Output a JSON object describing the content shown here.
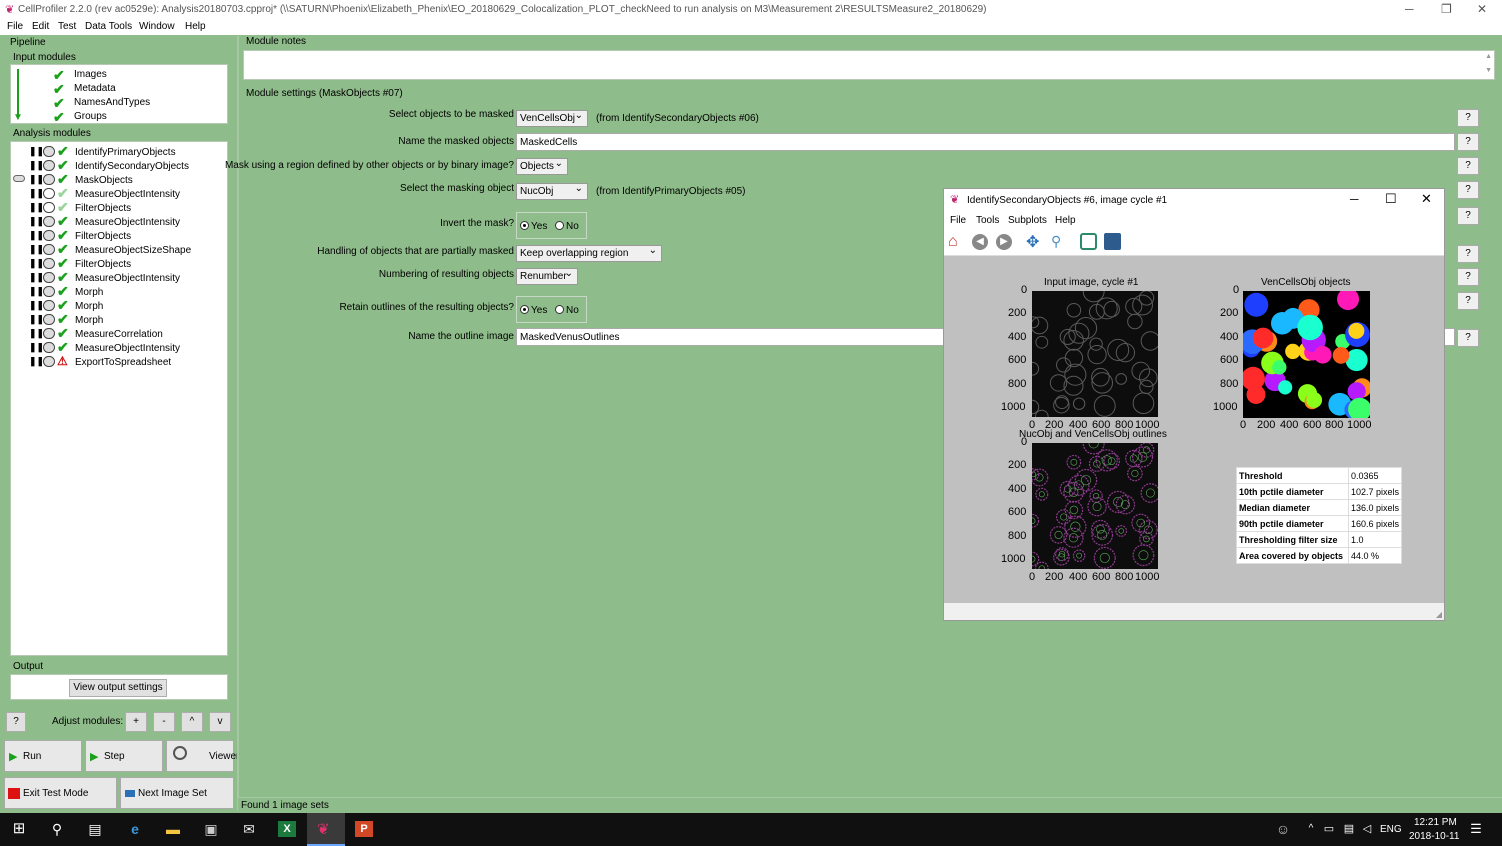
{
  "window": {
    "title": "CellProfiler 2.2.0 (rev ac0529e): Analysis20180703.cpproj* (\\\\SATURN\\Phoenix\\Elizabeth_Phenix\\EO_20180629_Colocalization_PLOT_checkNeed to run analysis on M3\\Measurement 2\\RESULTSMeasure2_20180629)",
    "minimize": "─",
    "restore": "❐",
    "close": "✕"
  },
  "menu": [
    "File",
    "Edit",
    "Test",
    "Data Tools",
    "Window",
    "Help"
  ],
  "pipeline": {
    "title": "Pipeline",
    "input_title": "Input modules",
    "input_modules": [
      "Images",
      "Metadata",
      "NamesAndTypes",
      "Groups"
    ],
    "analysis_title": "Analysis modules",
    "analysis_modules": [
      {
        "name": "IdentifyPrimaryObjects",
        "status": "ok"
      },
      {
        "name": "IdentifySecondaryObjects",
        "status": "ok"
      },
      {
        "name": "MaskObjects",
        "status": "ok"
      },
      {
        "name": "MeasureObjectIntensity",
        "status": "pending"
      },
      {
        "name": "FilterObjects",
        "status": "pending"
      },
      {
        "name": "MeasureObjectIntensity",
        "status": "ok"
      },
      {
        "name": "FilterObjects",
        "status": "ok"
      },
      {
        "name": "MeasureObjectSizeShape",
        "status": "ok"
      },
      {
        "name": "FilterObjects",
        "status": "ok"
      },
      {
        "name": "MeasureObjectIntensity",
        "status": "ok"
      },
      {
        "name": "Morph",
        "status": "ok"
      },
      {
        "name": "Morph",
        "status": "ok"
      },
      {
        "name": "Morph",
        "status": "ok"
      },
      {
        "name": "MeasureCorrelation",
        "status": "ok"
      },
      {
        "name": "MeasureObjectIntensity",
        "status": "ok"
      },
      {
        "name": "ExportToSpreadsheet",
        "status": "error"
      }
    ]
  },
  "output": {
    "title": "Output",
    "view_button": "View output settings"
  },
  "adjust": {
    "help": "?",
    "label": "Adjust modules:",
    "add": "+",
    "remove": "-",
    "up": "^",
    "down": "v"
  },
  "actions": {
    "run": "Run",
    "step": "Step",
    "viewer": "Viewer",
    "exit_test": "Exit Test Mode",
    "next_set": "Next Image Set"
  },
  "module_notes_title": "Module notes",
  "settings": {
    "title": "Module settings (MaskObjects #07)",
    "help": "?",
    "objects_label": "Select objects to be masked",
    "objects_value": "VenCellsObj",
    "objects_note": "(from IdentifySecondaryObjects #06)",
    "masked_name_label": "Name the masked objects",
    "masked_name_value": "MaskedCells",
    "mask_using_label": "Mask using a region defined by other objects or by binary image?",
    "mask_using_value": "Objects",
    "masking_object_label": "Select the masking object",
    "masking_object_value": "NucObj",
    "masking_object_note": "(from IdentifyPrimaryObjects #05)",
    "invert_label": "Invert the mask?",
    "yes": "Yes",
    "no": "No",
    "partial_label": "Handling of objects that are partially masked",
    "partial_value": "Keep overlapping region",
    "numbering_label": "Numbering of resulting objects",
    "numbering_value": "Renumber",
    "retain_label": "Retain outlines of the resulting objects?",
    "outline_label": "Name the outline image",
    "outline_value": "MaskedVenusOutlines"
  },
  "status_bar": "Found 1 image sets",
  "figure": {
    "title": "IdentifySecondaryObjects #6, image cycle #1",
    "menu": [
      "File",
      "Tools",
      "Subplots",
      "Help"
    ],
    "toolbar_icons": [
      "home-icon",
      "back-icon",
      "forward-icon",
      "pan-icon",
      "zoom-icon",
      "configure-icon",
      "save-icon"
    ],
    "panel1_title": "Input image, cycle #1",
    "panel2_title": "VenCellsObj objects",
    "panel3_title": "NucObj and VenCellsObj outlines",
    "y_ticks": [
      "0",
      "200",
      "400",
      "600",
      "800",
      "1000"
    ],
    "x_ticks": [
      "0",
      "200",
      "400",
      "600",
      "800",
      "1000"
    ],
    "stats": [
      {
        "k": "Threshold",
        "v": "0.0365"
      },
      {
        "k": "10th pctile diameter",
        "v": "102.7 pixels"
      },
      {
        "k": "Median diameter",
        "v": "136.0 pixels"
      },
      {
        "k": "90th pctile diameter",
        "v": "160.6 pixels"
      },
      {
        "k": "Thresholding filter size",
        "v": "1.0"
      },
      {
        "k": "Area covered by objects",
        "v": "44.0 %"
      }
    ]
  },
  "taskbar": {
    "lang": "ENG",
    "time": "12:21 PM",
    "date": "2018-10-11"
  }
}
